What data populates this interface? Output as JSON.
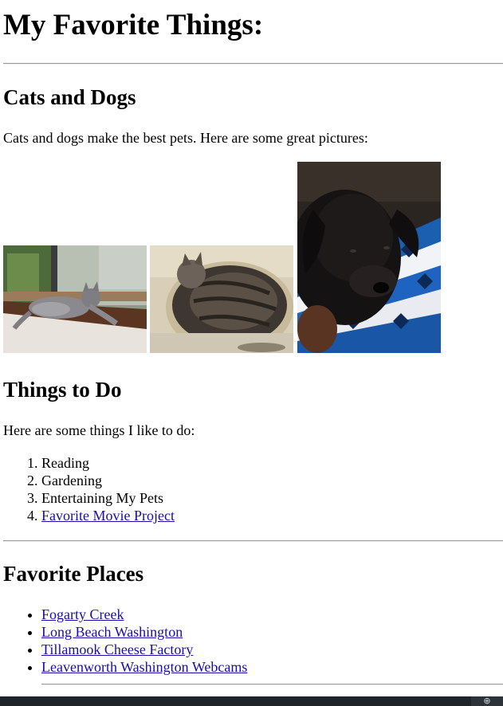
{
  "page": {
    "title": "My Favorite Things:"
  },
  "pets": {
    "heading": "Cats and Dogs",
    "intro": "Cats and dogs make the best pets. Here are some great pictures:",
    "photos": [
      {
        "subject": "gray tabby cat lying on a windowsill"
      },
      {
        "subject": "tabby cat curled up sleeping"
      },
      {
        "subject": "black dog lying on a blue patterned sweater"
      }
    ]
  },
  "todo": {
    "heading": "Things to Do",
    "intro": "Here are some things I like to do:",
    "items": [
      {
        "label": "Reading"
      },
      {
        "label": "Gardening"
      },
      {
        "label": "Entertaining My Pets"
      },
      {
        "label": "Favorite Movie Project"
      }
    ]
  },
  "places": {
    "heading": "Favorite Places",
    "items": [
      {
        "label": "Fogarty Creek"
      },
      {
        "label": "Long Beach Washington"
      },
      {
        "label": "Tillamook Cheese Factory"
      },
      {
        "label": "Leavenworth Washington Webcams"
      }
    ]
  },
  "taskbar": {
    "button_glyph": "⊕"
  },
  "colors": {
    "link": "#1a0dab",
    "rule": "#9a9a9a",
    "taskbar": "#1f2428"
  }
}
